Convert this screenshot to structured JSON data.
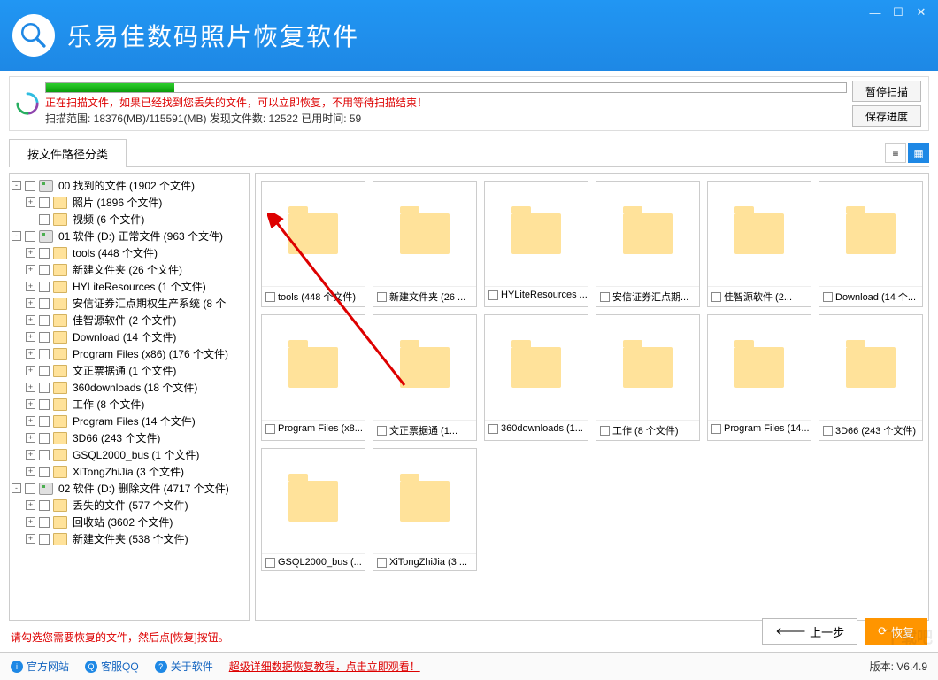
{
  "app": {
    "title": "乐易佳数码照片恢复软件"
  },
  "win": {
    "min": "—",
    "max": "☐",
    "close": "✕"
  },
  "scan": {
    "msg": "正在扫描文件，如果已经找到您丢失的文件，可以立即恢复，不用等待扫描结束！",
    "stats": "扫描范围: 18376(MB)/115591(MB)    发现文件数: 12522    已用时间: 59",
    "progress_pct": 16,
    "pause": "暂停扫描",
    "save": "保存进度"
  },
  "tab": {
    "byPath": "按文件路径分类"
  },
  "tree": [
    {
      "exp": "-",
      "ind": 0,
      "ico": "disk",
      "lbl": "00 找到的文件   (1902 个文件)"
    },
    {
      "exp": "+",
      "ind": 1,
      "ico": "fold",
      "lbl": "照片    (1896 个文件)"
    },
    {
      "exp": "",
      "ind": 1,
      "ico": "fold",
      "lbl": "视频    (6 个文件)"
    },
    {
      "exp": "-",
      "ind": 0,
      "ico": "disk",
      "lbl": "01 软件 (D:) 正常文件 (963 个文件)"
    },
    {
      "exp": "+",
      "ind": 1,
      "ico": "fold",
      "lbl": "tools    (448 个文件)"
    },
    {
      "exp": "+",
      "ind": 1,
      "ico": "fold",
      "lbl": "新建文件夹    (26 个文件)"
    },
    {
      "exp": "+",
      "ind": 1,
      "ico": "fold",
      "lbl": "HYLiteResources    (1 个文件)"
    },
    {
      "exp": "+",
      "ind": 1,
      "ico": "fold",
      "lbl": "安信证券汇点期权生产系统    (8 个"
    },
    {
      "exp": "+",
      "ind": 1,
      "ico": "fold",
      "lbl": "佳智源软件    (2 个文件)"
    },
    {
      "exp": "+",
      "ind": 1,
      "ico": "fold",
      "lbl": "Download    (14 个文件)"
    },
    {
      "exp": "+",
      "ind": 1,
      "ico": "fold",
      "lbl": "Program Files (x86)    (176 个文件)"
    },
    {
      "exp": "+",
      "ind": 1,
      "ico": "fold",
      "lbl": "文正票据通    (1 个文件)"
    },
    {
      "exp": "+",
      "ind": 1,
      "ico": "fold",
      "lbl": "360downloads    (18 个文件)"
    },
    {
      "exp": "+",
      "ind": 1,
      "ico": "fold",
      "lbl": "工作    (8 个文件)"
    },
    {
      "exp": "+",
      "ind": 1,
      "ico": "fold",
      "lbl": "Program Files    (14 个文件)"
    },
    {
      "exp": "+",
      "ind": 1,
      "ico": "fold",
      "lbl": "3D66    (243 个文件)"
    },
    {
      "exp": "+",
      "ind": 1,
      "ico": "fold",
      "lbl": "GSQL2000_bus    (1 个文件)"
    },
    {
      "exp": "+",
      "ind": 1,
      "ico": "fold",
      "lbl": "XiTongZhiJia    (3 个文件)"
    },
    {
      "exp": "-",
      "ind": 0,
      "ico": "disk",
      "lbl": "02 软件 (D:) 删除文件 (4717 个文件)"
    },
    {
      "exp": "+",
      "ind": 1,
      "ico": "fold",
      "lbl": "丢失的文件    (577 个文件)"
    },
    {
      "exp": "+",
      "ind": 1,
      "ico": "fold",
      "lbl": "回收站    (3602 个文件)"
    },
    {
      "exp": "+",
      "ind": 1,
      "ico": "fold",
      "lbl": "新建文件夹    (538 个文件)"
    }
  ],
  "thumbs": [
    "tools  (448 个文件)",
    "新建文件夹  (26 ...",
    "HYLiteResources ...",
    "安信证券汇点期...",
    "佳智源软件   (2...",
    "Download  (14 个...",
    "Program Files (x8...",
    "文正票据通   (1...",
    "360downloads  (1...",
    "工作  (8 个文件)",
    "Program Files  (14...",
    "3D66  (243 个文件)",
    "GSQL2000_bus  (...",
    "XiTongZhiJia  (3 ..."
  ],
  "note": "请勾选您需要恢复的文件，然后点[恢复]按钮。",
  "btns": {
    "prev": "上一步",
    "recover": "恢复"
  },
  "footer": {
    "site": "官方网站",
    "qq": "客服QQ",
    "about": "关于软件",
    "tutorial": "超级详细数据恢复教程，点击立即观看！",
    "version": "版本: V6.4.9"
  },
  "wm": "下载吧"
}
